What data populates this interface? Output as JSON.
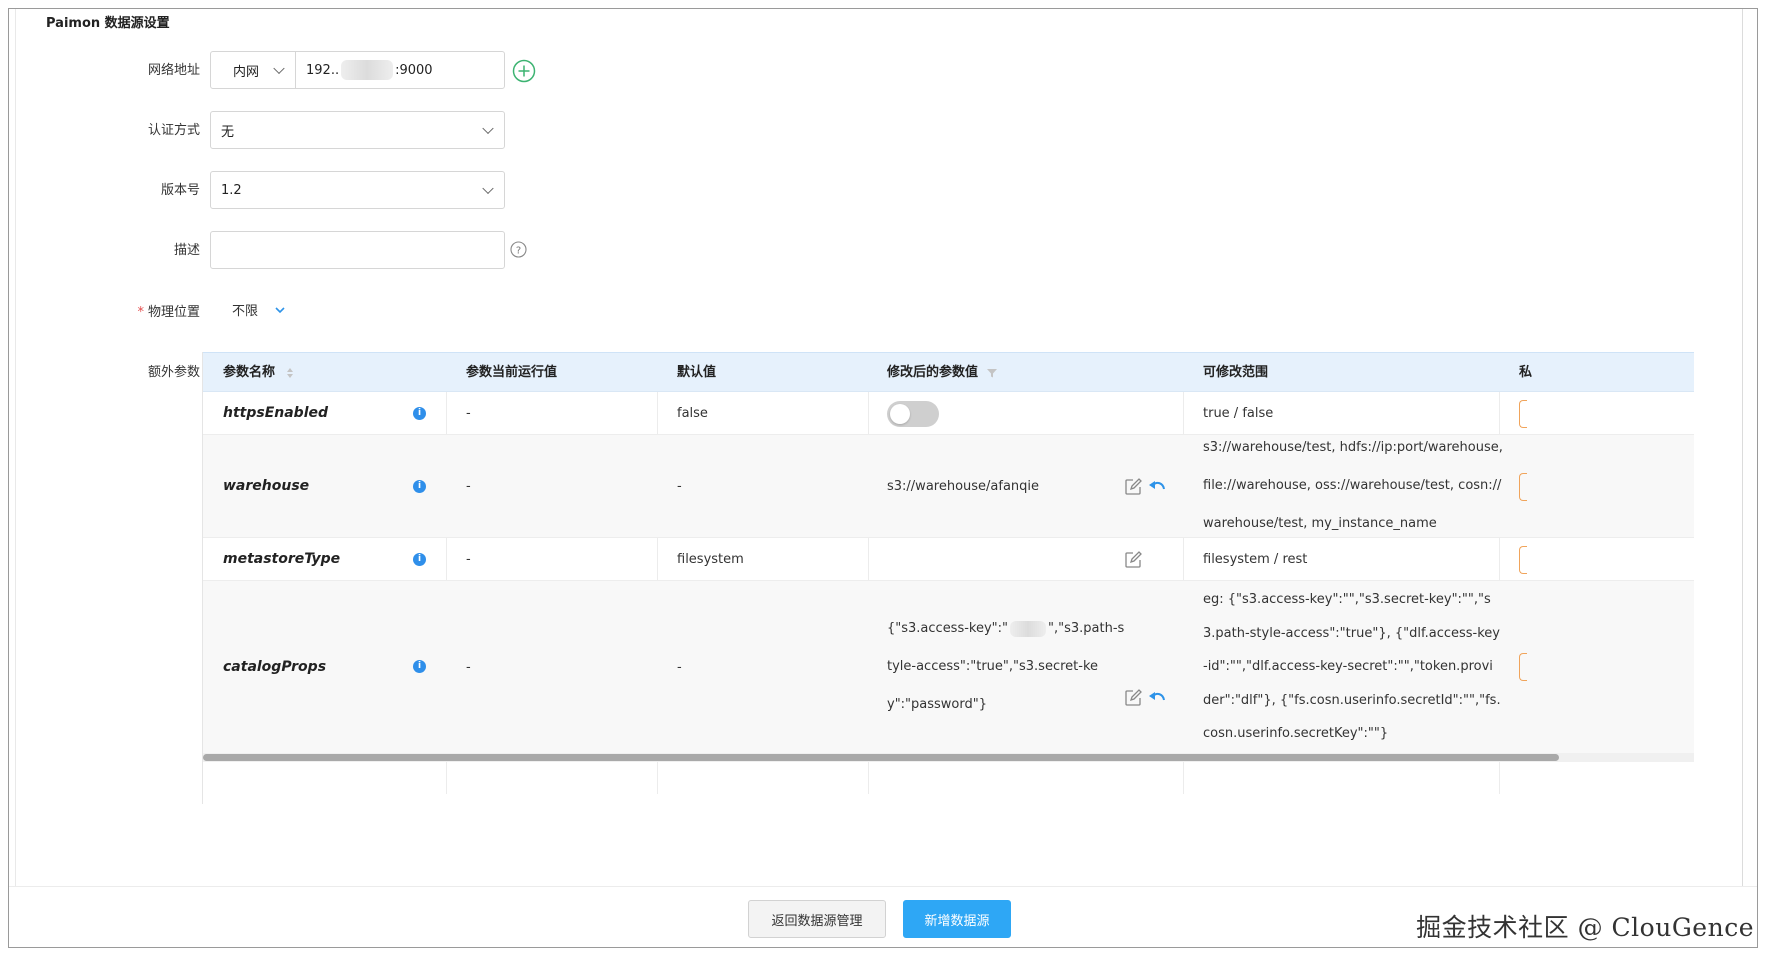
{
  "form": {
    "section_title": "Paimon 数据源设置",
    "network_label": "网络地址",
    "network_type": "内网",
    "ip_prefix": "192.",
    "ip_dots": ".",
    "ip_suffix": ":9000",
    "auth_label": "认证方式",
    "auth_value": "无",
    "version_label": "版本号",
    "version_value": "1.2",
    "desc_label": "描述",
    "desc_value": "",
    "location_required": "*",
    "location_label": "物理位置",
    "location_value": "不限",
    "extra_label": "额外参数"
  },
  "table": {
    "headers": [
      "参数名称",
      "参数当前运行值",
      "默认值",
      "修改后的参数值",
      "可修改范围",
      "私"
    ],
    "rows": [
      {
        "name": "httpsEnabled",
        "current": "-",
        "default": "false",
        "modified": "",
        "toggle_on": false,
        "range": [
          "true / false"
        ]
      },
      {
        "name": "warehouse",
        "current": "-",
        "default": "-",
        "modified": "s3://warehouse/afanqie",
        "range": [
          "s3://warehouse/test, hdfs://ip:port/warehouse,",
          "file://warehouse, oss://warehouse/test, cosn://",
          "warehouse/test, my_instance_name"
        ]
      },
      {
        "name": "metastoreType",
        "current": "-",
        "default": "filesystem",
        "modified": "",
        "range": [
          "filesystem / rest"
        ]
      },
      {
        "name": "catalogProps",
        "current": "-",
        "default": "-",
        "modified_line1_a": "{\"s3.access-key\":\"",
        "modified_line1_b": "\",\"s3.path-s",
        "modified_line2": "tyle-access\":\"true\",\"s3.secret-ke",
        "modified_line3": "y\":\"password\"}",
        "range": [
          "eg: {\"s3.access-key\":\"\",\"s3.secret-key\":\"\",\"s",
          "3.path-style-access\":\"true\"}, {\"dlf.access-key",
          "-id\":\"\",\"dlf.access-key-secret\":\"\",\"token.provi",
          "der\":\"dlf\"}, {\"fs.cosn.userinfo.secretId\":\"\",\"fs.",
          "cosn.userinfo.secretKey\":\"\"}"
        ]
      }
    ]
  },
  "footer": {
    "back_button": "返回数据源管理",
    "add_button": "新增数据源",
    "watermark": "掘金技术社区 @ ClouGence"
  },
  "colors": {
    "primary": "#2ea7f5",
    "info": "#2f8fea",
    "add_icon": "#3cb371",
    "header_bg": "#e6f1fc"
  },
  "icons": [
    "chevron-down-icon",
    "add-circle-icon",
    "help-icon",
    "info-icon",
    "edit-icon",
    "undo-icon",
    "sort-icon",
    "filter-icon"
  ]
}
